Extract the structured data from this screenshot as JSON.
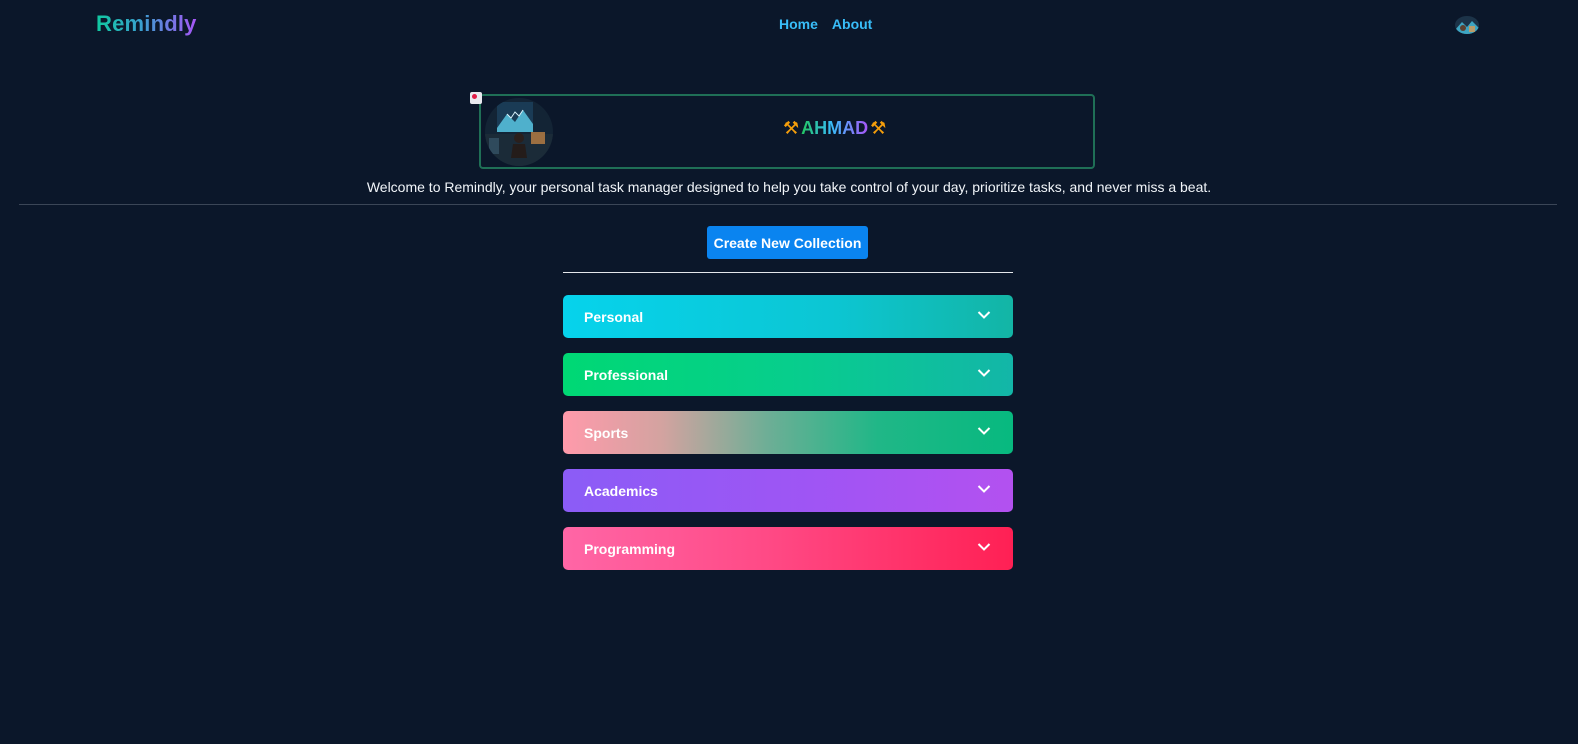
{
  "nav": {
    "brand": "Remindly",
    "links": [
      "Home",
      "About"
    ],
    "avatar_icon": "user-avatar-icon"
  },
  "profile": {
    "name": "AHMAD",
    "name_icon": "hammer-and-pick",
    "name_icon_glyph": "⚒",
    "avatar_icon": "profile-picture"
  },
  "welcome_text": "Welcome to Remindly, your personal task manager designed to help you take control of your day, prioritize tasks, and never miss a beat.",
  "create_button_label": "Create New Collection",
  "collections": [
    {
      "label": "Personal",
      "icon": "chevron-down-icon"
    },
    {
      "label": "Professional",
      "icon": "chevron-down-icon"
    },
    {
      "label": "Sports",
      "icon": "chevron-down-icon"
    },
    {
      "label": "Academics",
      "icon": "chevron-down-icon"
    },
    {
      "label": "Programming",
      "icon": "chevron-down-icon"
    }
  ],
  "colors": {
    "background": "#0b172a",
    "nav_link": "#38bdf8",
    "button": "#0a84f0",
    "profile_border": "#1f6f56"
  }
}
